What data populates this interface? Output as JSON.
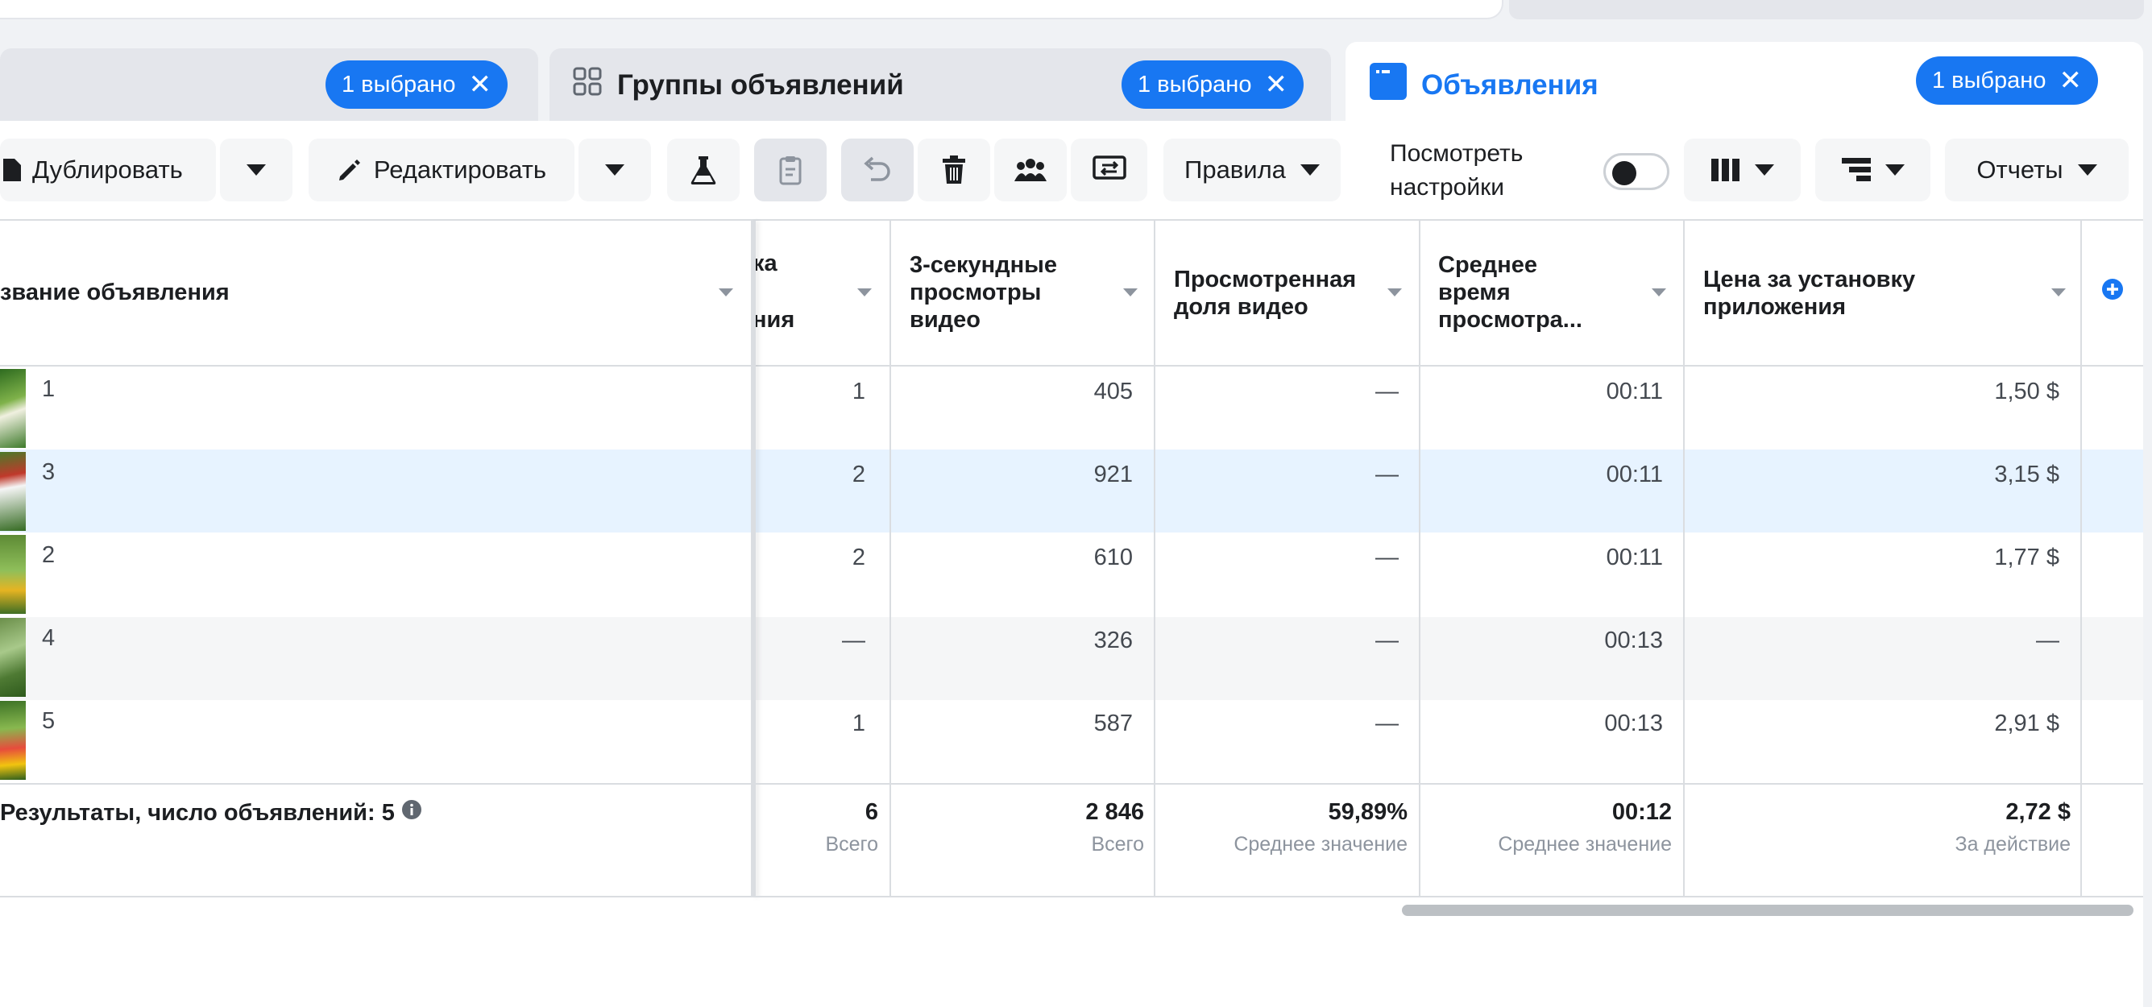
{
  "tabs": {
    "campaigns_badge": "1 выбрано",
    "adsets_title": "Группы объявлений",
    "adsets_badge": "1 выбрано",
    "ads_title": "Объявления",
    "ads_badge": "1 выбрано",
    "close_glyph": "✕"
  },
  "toolbar": {
    "duplicate": "Дублировать",
    "edit": "Редактировать",
    "rules": "Правила",
    "view_settings": [
      "Посмотреть",
      "настройки"
    ],
    "reports": "Отчеты",
    "view_settings_toggle": "off"
  },
  "table": {
    "headers": {
      "name": "звание объявления",
      "results_partial": [
        "ка",
        "ния"
      ],
      "views3s": [
        "3-секундные",
        "просмотры",
        "видео"
      ],
      "watched_share": [
        "Просмотренная",
        "доля видео"
      ],
      "avg_time": [
        "Среднее",
        "время",
        "просмотра..."
      ],
      "install_cost": [
        "Цена за установку",
        "приложения"
      ]
    },
    "rows": [
      {
        "name": "1",
        "results": "1",
        "views": "405",
        "share": "—",
        "time": "00:11",
        "cost": "1,50 $"
      },
      {
        "name": "3",
        "results": "2",
        "views": "921",
        "share": "—",
        "time": "00:11",
        "cost": "3,15 $"
      },
      {
        "name": "2",
        "results": "2",
        "views": "610",
        "share": "—",
        "time": "00:11",
        "cost": "1,77 $"
      },
      {
        "name": "4",
        "results": "—",
        "views": "326",
        "share": "—",
        "time": "00:13",
        "cost": "—"
      },
      {
        "name": "5",
        "results": "1",
        "views": "587",
        "share": "—",
        "time": "00:13",
        "cost": "2,91 $"
      }
    ],
    "summary": {
      "label": "Результаты, число объявлений: 5",
      "results": "6",
      "results_sub": "Всего",
      "views": "2 846",
      "views_sub": "Всего",
      "share": "59,89%",
      "share_sub": "Среднее значение",
      "time": "00:12",
      "time_sub": "Среднее значение",
      "cost": "2,72 $",
      "cost_sub": "За действие"
    }
  },
  "colors": {
    "accent": "#1877f2",
    "selected_row": "#e7f3ff",
    "alt_row": "#f5f6f7"
  }
}
